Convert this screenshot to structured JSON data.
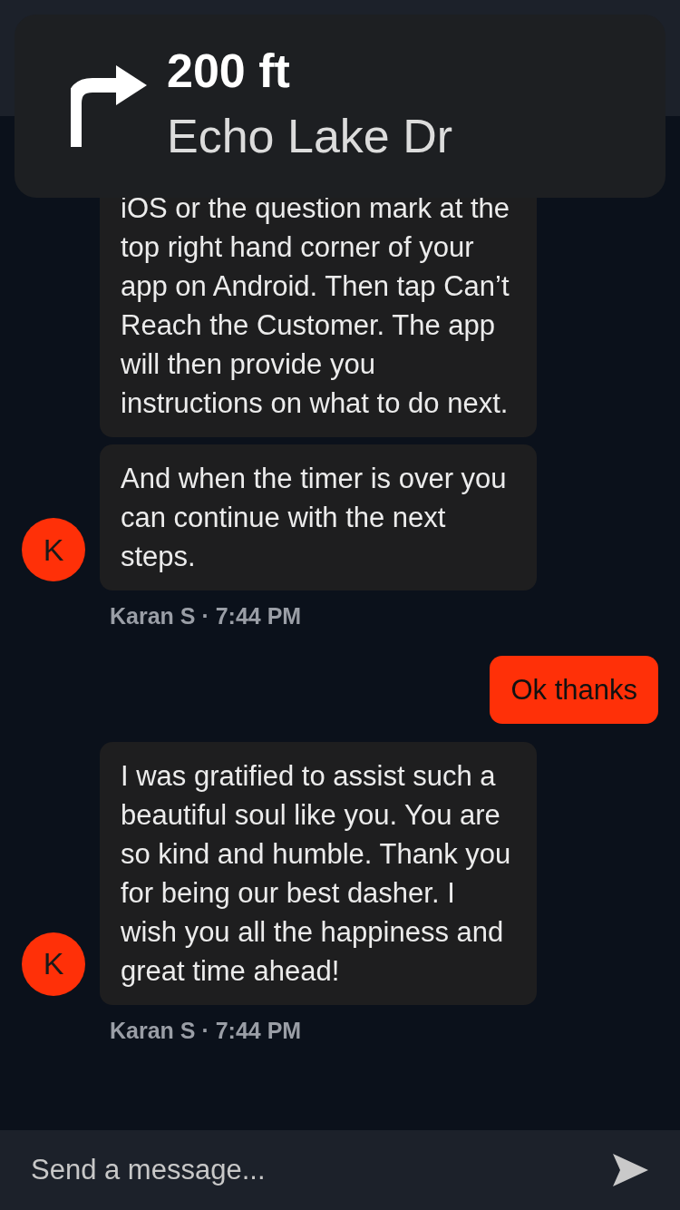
{
  "navigation": {
    "distance": "200 ft",
    "street": "Echo Lake Dr"
  },
  "messages": [
    {
      "kind": "incoming",
      "text": "iOS or the question mark at the top right hand corner of your app on Android. Then tap Can’t Reach the Customer. The app will then provide you instructions on what to do next."
    },
    {
      "kind": "incoming",
      "text": "And when the timer is over you can continue with the next steps.",
      "avatar": "K",
      "sender": "Karan S · 7:44 PM"
    },
    {
      "kind": "outgoing",
      "text": "Ok thanks"
    },
    {
      "kind": "incoming",
      "text": "I was gratified to assist such a beautiful soul like you. You are so kind and humble. Thank you for being our best dasher. I wish you all the happiness and great time ahead!",
      "avatar": "K",
      "sender": "Karan S · 7:44 PM"
    }
  ],
  "composer": {
    "placeholder": "Send a message..."
  }
}
